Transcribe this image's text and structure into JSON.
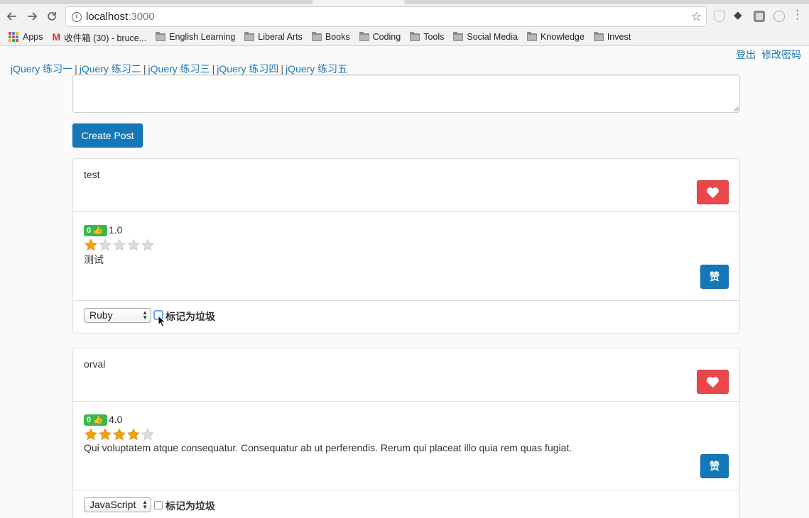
{
  "browser": {
    "url_host": "localhost",
    "url_port": ":3000",
    "bookmarks": [
      {
        "label": "Apps",
        "kind": "apps"
      },
      {
        "label": "收件箱 (30) - bruce...",
        "kind": "gmail"
      },
      {
        "label": "English Learning",
        "kind": "folder"
      },
      {
        "label": "Liberal Arts",
        "kind": "folder"
      },
      {
        "label": "Books",
        "kind": "folder"
      },
      {
        "label": "Coding",
        "kind": "folder"
      },
      {
        "label": "Tools",
        "kind": "folder"
      },
      {
        "label": "Social Media",
        "kind": "folder"
      },
      {
        "label": "Knowledge",
        "kind": "folder"
      },
      {
        "label": "Invest",
        "kind": "folder"
      }
    ]
  },
  "header": {
    "logout": "登出",
    "change_password": "修改密码"
  },
  "nav": {
    "links": [
      "jQuery 练习一",
      "jQuery 练习二",
      "jQuery 练习三",
      "jQuery 练习四",
      "jQuery 练习五"
    ],
    "separator": "|"
  },
  "composer": {
    "value": "",
    "create_label": "Create Post"
  },
  "posts": [
    {
      "title": "test",
      "likes": "0",
      "like_icon": "thumbs-up-icon",
      "rating": "1.0",
      "stars": 1,
      "content": "测试",
      "like_button": "赞",
      "category": "Ruby",
      "spam_label": "标记为垃圾",
      "spam_checked": false
    },
    {
      "title": "orval",
      "likes": "0",
      "like_icon": "thumbs-up-icon",
      "rating": "4.0",
      "stars": 4,
      "content": "Qui voluptatem atque consequatur. Consequatur ab ut perferendis. Rerum qui placeat illo quia rem quas fugiat.",
      "like_button": "赞",
      "category": "JavaScript",
      "spam_label": "标记为垃圾",
      "spam_checked": false
    }
  ],
  "colors": {
    "link": "#1f78b4",
    "primary": "#1478b8",
    "danger": "#e9474a",
    "success": "#3cb84a",
    "star_on": "#f2a10c",
    "star_off": "#dcdcdc"
  }
}
